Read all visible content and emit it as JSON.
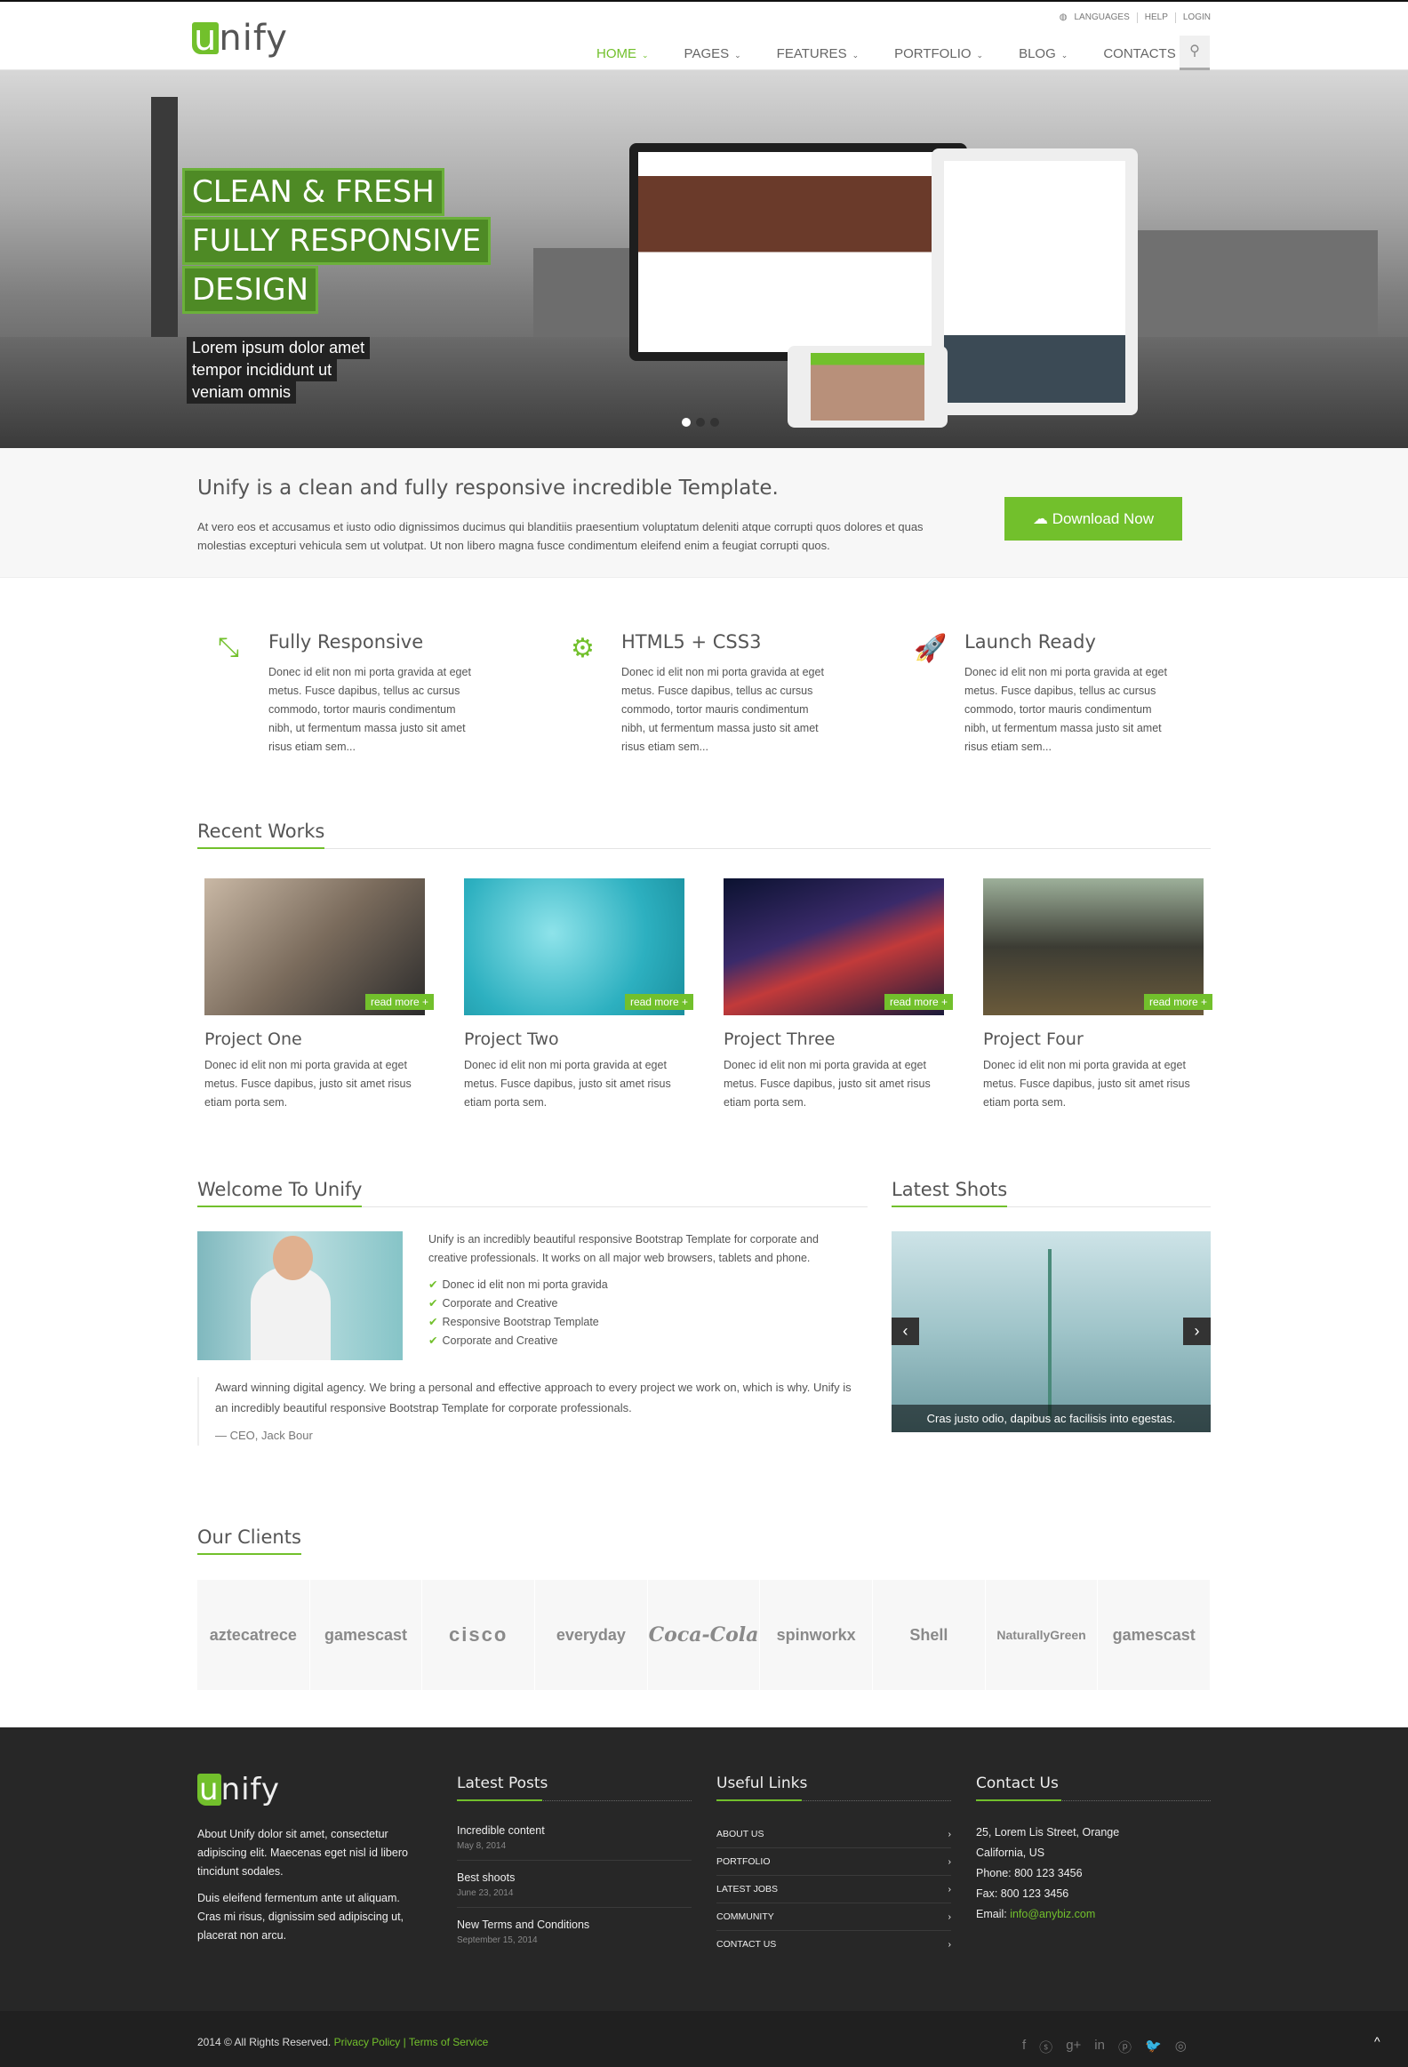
{
  "header": {
    "logo": "unify",
    "topbar": [
      "LANGUAGES",
      "HELP",
      "LOGIN"
    ],
    "nav": [
      "HOME",
      "PAGES",
      "FEATURES",
      "PORTFOLIO",
      "BLOG",
      "CONTACTS"
    ]
  },
  "hero": {
    "captions": [
      "CLEAN & FRESH",
      "FULLY RESPONSIVE",
      "DESIGN"
    ],
    "sub": [
      "Lorem ipsum dolor amet",
      "tempor incididunt ut",
      "veniam omnis"
    ],
    "slides": 3,
    "active_slide": 1
  },
  "promo": {
    "title": "Unify is a clean and fully responsive incredible Template.",
    "text": "At vero eos et accusamus et iusto odio dignissimos ducimus qui blanditiis praesentium voluptatum deleniti atque corrupti quos dolores et quas molestias excepturi vehicula sem ut volutpat. Ut non libero magna fusce condimentum eleifend enim a feugiat corrupti quos.",
    "button": "Download Now"
  },
  "features": [
    {
      "title": "Fully Responsive",
      "text": "Donec id elit non mi porta gravida at eget metus. Fusce dapibus, tellus ac cursus commodo, tortor mauris condimentum nibh, ut fermentum massa justo sit amet risus etiam sem..."
    },
    {
      "title": "HTML5 + CSS3",
      "text": "Donec id elit non mi porta gravida at eget metus. Fusce dapibus, tellus ac cursus commodo, tortor mauris condimentum nibh, ut fermentum massa justo sit amet risus etiam sem..."
    },
    {
      "title": "Launch Ready",
      "text": "Donec id elit non mi porta gravida at eget metus. Fusce dapibus, tellus ac cursus commodo, tortor mauris condimentum nibh, ut fermentum massa justo sit amet risus etiam sem..."
    }
  ],
  "recent": {
    "title": "Recent Works",
    "read_more": "read more +",
    "items": [
      {
        "title": "Project One",
        "text": "Donec id elit non mi porta gravida at eget metus. Fusce dapibus, justo sit amet risus etiam porta sem."
      },
      {
        "title": "Project Two",
        "text": "Donec id elit non mi porta gravida at eget metus. Fusce dapibus, justo sit amet risus etiam porta sem."
      },
      {
        "title": "Project Three",
        "text": "Donec id elit non mi porta gravida at eget metus. Fusce dapibus, justo sit amet risus etiam porta sem."
      },
      {
        "title": "Project Four",
        "text": "Donec id elit non mi porta gravida at eget metus. Fusce dapibus, justo sit amet risus etiam porta sem."
      }
    ]
  },
  "welcome": {
    "title": "Welcome To Unify",
    "text": "Unify is an incredibly beautiful responsive Bootstrap Template for corporate and creative professionals. It works on all major web browsers, tablets and phone.",
    "checks": [
      "Donec id elit non mi porta gravida",
      "Corporate and Creative",
      "Responsive Bootstrap Template",
      "Corporate and Creative"
    ],
    "quote": "Award winning digital agency. We bring a personal and effective approach to every project we work on, which is why. Unify is an incredibly beautiful responsive Bootstrap Template for corporate professionals.",
    "author": "— CEO, Jack Bour"
  },
  "shots": {
    "title": "Latest Shots",
    "caption": "Cras justo odio, dapibus ac facilisis into egestas."
  },
  "clients": {
    "title": "Our Clients",
    "logos": [
      "aztecatrece",
      "gamescast",
      "cisco",
      "everyday",
      "Coca-Cola",
      "spinworkx",
      "Shell",
      "NaturallyGreen",
      "gamescast"
    ]
  },
  "footer": {
    "logo": "unify",
    "about": [
      "About Unify dolor sit amet, consectetur adipiscing elit. Maecenas eget nisl id libero tincidunt sodales.",
      "Duis eleifend fermentum ante ut aliquam. Cras mi risus, dignissim sed adipiscing ut, placerat non arcu."
    ],
    "posts_title": "Latest Posts",
    "posts": [
      {
        "title": "Incredible content",
        "date": "May 8, 2014"
      },
      {
        "title": "Best shoots",
        "date": "June 23, 2014"
      },
      {
        "title": "New Terms and Conditions",
        "date": "September 15, 2014"
      }
    ],
    "links_title": "Useful Links",
    "links": [
      "ABOUT US",
      "PORTFOLIO",
      "LATEST JOBS",
      "COMMUNITY",
      "CONTACT US"
    ],
    "contact_title": "Contact Us",
    "address1": "25, Lorem Lis Street, Orange",
    "address2": "California, US",
    "phone": "Phone: 800 123 3456",
    "fax": "Fax: 800 123 3456",
    "email_label": "Email: ",
    "email": "info@anybiz.com"
  },
  "copyright": {
    "text": "2014 © All Rights Reserved.",
    "privacy": "Privacy Policy",
    "sep": "|",
    "terms": "Terms of Service"
  },
  "colors": {
    "accent": "#72c02c",
    "footer": "#272727"
  }
}
